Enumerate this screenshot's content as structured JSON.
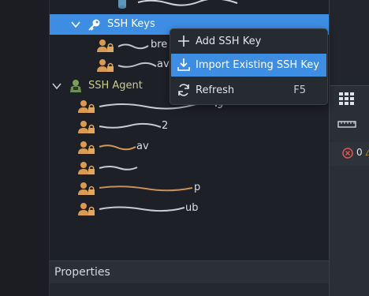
{
  "tree": {
    "ssh_keys_label": "SSH Keys",
    "ssh_agent_label": "SSH Agent",
    "key_rows": [
      {
        "suffix": "bre"
      },
      {
        "suffix": "av"
      }
    ],
    "agent_rows": [
      {
        "suffix": "9"
      },
      {
        "suffix": "2"
      },
      {
        "suffix": "av"
      },
      {
        "suffix": ""
      },
      {
        "suffix": "p"
      },
      {
        "suffix": "ub"
      }
    ]
  },
  "context_menu": {
    "items": [
      {
        "label": "Add SSH Key",
        "shortcut": ""
      },
      {
        "label": "Import Existing SSH Key",
        "shortcut": ""
      },
      {
        "label": "Refresh",
        "shortcut": "F5"
      }
    ]
  },
  "status": {
    "error_count": "0"
  },
  "properties": {
    "title": "Properties"
  }
}
